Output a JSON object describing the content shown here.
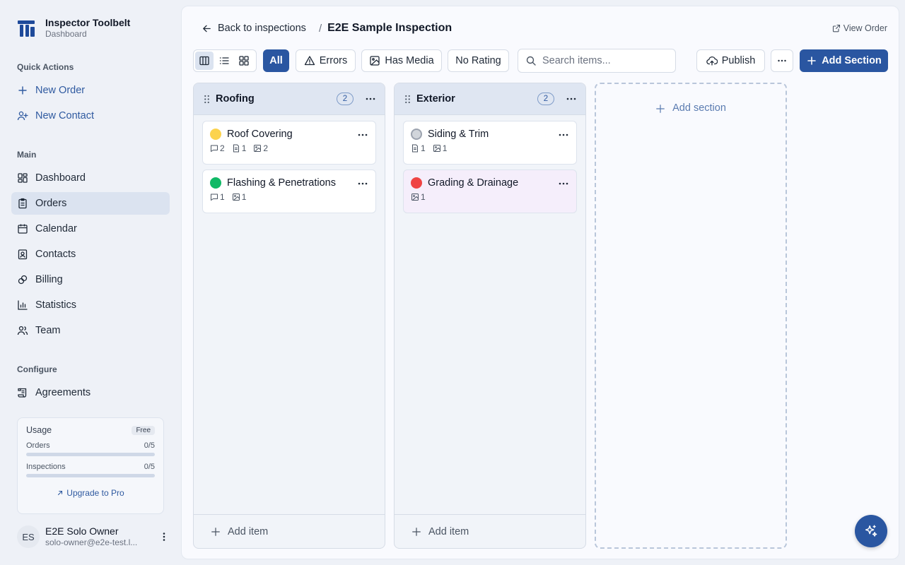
{
  "brand": {
    "title": "Inspector Toolbelt",
    "subtitle": "Dashboard"
  },
  "sidebar": {
    "quick_actions_label": "Quick Actions",
    "quick_actions": [
      {
        "label": "New Order",
        "icon": "plus-icon"
      },
      {
        "label": "New Contact",
        "icon": "user-plus-icon"
      }
    ],
    "main_label": "Main",
    "main_items": [
      {
        "label": "Dashboard",
        "icon": "grid-icon"
      },
      {
        "label": "Orders",
        "icon": "clipboard-icon",
        "active": true
      },
      {
        "label": "Calendar",
        "icon": "calendar-icon"
      },
      {
        "label": "Contacts",
        "icon": "contact-card-icon"
      },
      {
        "label": "Billing",
        "icon": "billing-icon"
      },
      {
        "label": "Statistics",
        "icon": "bar-chart-icon"
      },
      {
        "label": "Team",
        "icon": "users-icon"
      }
    ],
    "configure_label": "Configure",
    "configure_items": [
      {
        "label": "Agreements",
        "icon": "scroll-icon"
      }
    ]
  },
  "usage": {
    "title": "Usage",
    "plan": "Free",
    "orders_label": "Orders",
    "orders_value": "0/5",
    "orders_fraction": 0,
    "inspections_label": "Inspections",
    "inspections_value": "0/5",
    "inspections_fraction": 0,
    "upgrade_label": "Upgrade to Pro"
  },
  "user": {
    "initials": "ES",
    "name": "E2E Solo Owner",
    "email": "solo-owner@e2e-test.l..."
  },
  "header": {
    "back_label": "Back to inspections",
    "separator": "/",
    "title": "E2E Sample Inspection",
    "view_order_label": "View Order"
  },
  "toolbar": {
    "filters": {
      "all": "All",
      "errors": "Errors",
      "has_media": "Has Media",
      "no_rating": "No Rating"
    },
    "search_placeholder": "Search items...",
    "publish_label": "Publish",
    "add_section_label": "Add Section"
  },
  "board": {
    "columns": [
      {
        "title": "Roofing",
        "count": "2",
        "items": [
          {
            "title": "Roof Covering",
            "status_color": "#fcd34d",
            "comments": "2",
            "docs": "1",
            "images": "2"
          },
          {
            "title": "Flashing & Penetrations",
            "status_color": "#10b966",
            "comments": "1",
            "images": "1"
          }
        ],
        "add_item_label": "Add item"
      },
      {
        "title": "Exterior",
        "count": "2",
        "items": [
          {
            "title": "Siding & Trim",
            "status_color": "#d1d5db",
            "docs": "1",
            "images": "1"
          },
          {
            "title": "Grading & Drainage",
            "status_color": "#ef4444",
            "images": "1"
          }
        ],
        "add_item_label": "Add item"
      }
    ],
    "add_section_label": "Add section"
  },
  "colors": {
    "primary": "#2a56a1",
    "active_nav": "#dbe3f0",
    "accent_link": "#2f5aa0"
  }
}
